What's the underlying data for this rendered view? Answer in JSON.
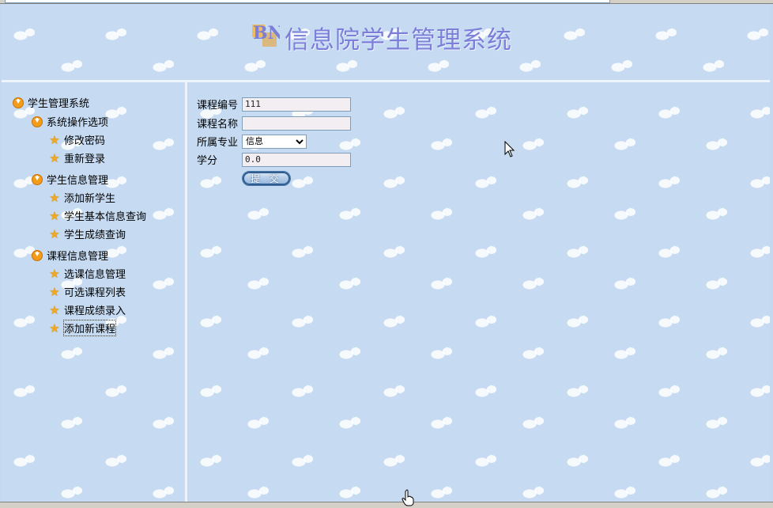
{
  "header": {
    "title": "信息院学生管理系统",
    "logo_text": "BN",
    "logo_icon": "school-logo-icon"
  },
  "sidebar": {
    "root": {
      "label": "学生管理系统",
      "icon": "collapse-circle-icon"
    },
    "groups": [
      {
        "label": "系统操作选项",
        "icon": "collapse-circle-icon",
        "items": [
          {
            "label": "修改密码",
            "icon": "star-icon"
          },
          {
            "label": "重新登录",
            "icon": "star-icon"
          }
        ]
      },
      {
        "label": "学生信息管理",
        "icon": "collapse-circle-icon",
        "items": [
          {
            "label": "添加新学生",
            "icon": "star-icon"
          },
          {
            "label": "学生基本信息查询",
            "icon": "star-icon"
          },
          {
            "label": "学生成绩查询",
            "icon": "star-icon"
          }
        ]
      },
      {
        "label": "课程信息管理",
        "icon": "collapse-circle-icon",
        "items": [
          {
            "label": "选课信息管理",
            "icon": "star-icon"
          },
          {
            "label": "可选课程列表",
            "icon": "star-icon"
          },
          {
            "label": "课程成绩录入",
            "icon": "star-icon"
          },
          {
            "label": "添加新课程",
            "icon": "star-icon",
            "selected": true
          }
        ]
      }
    ]
  },
  "form": {
    "course_id": {
      "label": "课程编号",
      "value": "111"
    },
    "course_name": {
      "label": "课程名称",
      "value": ""
    },
    "major": {
      "label": "所属专业",
      "value": "信息"
    },
    "credit": {
      "label": "学分",
      "value": "0.0"
    },
    "submit_label": "提 交"
  },
  "colors": {
    "title": "#7b7fd8",
    "background": "#c6dbf2",
    "tree_icon": "#f39c1a",
    "star": "#f0a820"
  }
}
